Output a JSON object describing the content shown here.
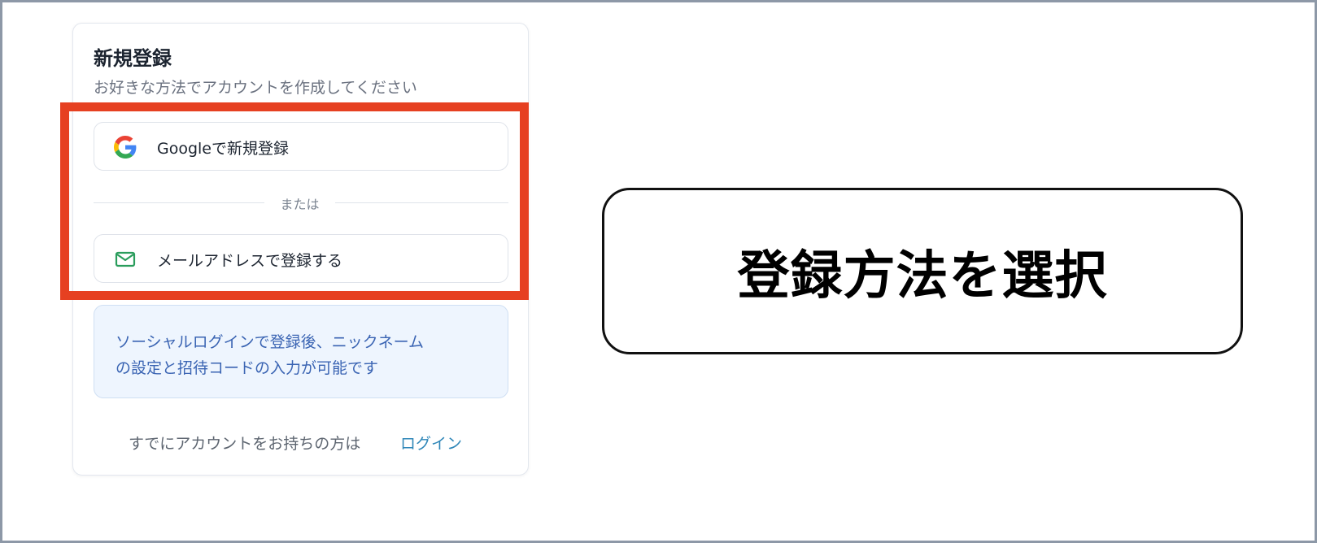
{
  "signup": {
    "title": "新規登録",
    "subtitle": "お好きな方法でアカウントを作成してください",
    "google_button_label": "Googleで新規登録",
    "divider_text": "または",
    "email_button_label": "メールアドレスで登録する",
    "info_line1": "ソーシャルログインで登録後、ニックネーム",
    "info_line2": "の設定と招待コードの入力が可能です",
    "footer_text": "すでにアカウントをお持ちの方は",
    "login_link": "ログイン"
  },
  "annotation": {
    "callout_text": "登録方法を選択",
    "highlight_color": "#e64021"
  },
  "icons": {
    "google": "google-icon",
    "email": "mail-icon"
  },
  "colors": {
    "link": "#2e86b8",
    "info_text": "#3a64b3",
    "info_bg": "#eef5fe",
    "mail_icon": "#2a9d5c"
  }
}
